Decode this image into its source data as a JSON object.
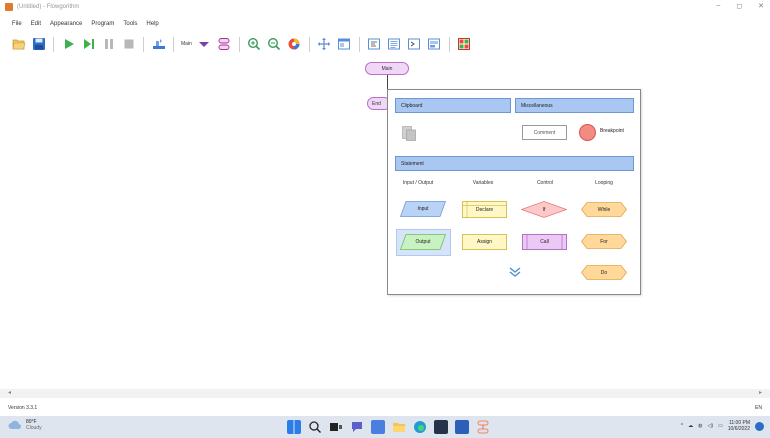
{
  "window": {
    "title": "(Untitled) - Flowgorithm",
    "controls": [
      "–",
      "◻",
      "✕"
    ]
  },
  "menu": [
    "File",
    "Edit",
    "Appearance",
    "Program",
    "Tools",
    "Help"
  ],
  "toolbar": {
    "function_select": "Main"
  },
  "flowchart": {
    "start_label": "Main",
    "end_label": "End"
  },
  "palette": {
    "clipboard_header": "Clipboard",
    "misc_header": "Miscellaneous",
    "comment_label": "Comment",
    "breakpoint_label": "Breakpoint",
    "statement_header": "Statement",
    "columns": [
      "Input / Output",
      "Variables",
      "Control",
      "Looping"
    ],
    "input_label": "Input",
    "output_label": "Output",
    "declare_label": "Declare",
    "assign_label": "Assign",
    "if_label": "If",
    "call_label": "Call",
    "while_label": "While",
    "for_label": "For",
    "do_label": "Do"
  },
  "status": {
    "version": "Version 3.3.1",
    "language": "EN"
  },
  "taskbar": {
    "temperature": "80°F",
    "weather": "Cloudy",
    "time": "11:00 PM",
    "date": "10/6/2022"
  },
  "colors": {
    "header_blue": "#aac7f2",
    "pill_purple": "#f0d6f7",
    "input_blue": "#b9d3f6",
    "output_green": "#c9f2c2",
    "declare_yellow": "#fff8c4",
    "if_pink": "#ffc8c8",
    "call_purple": "#ecc9f4",
    "loop_orange": "#ffd89a",
    "breakpoint_red": "#f28b82"
  }
}
